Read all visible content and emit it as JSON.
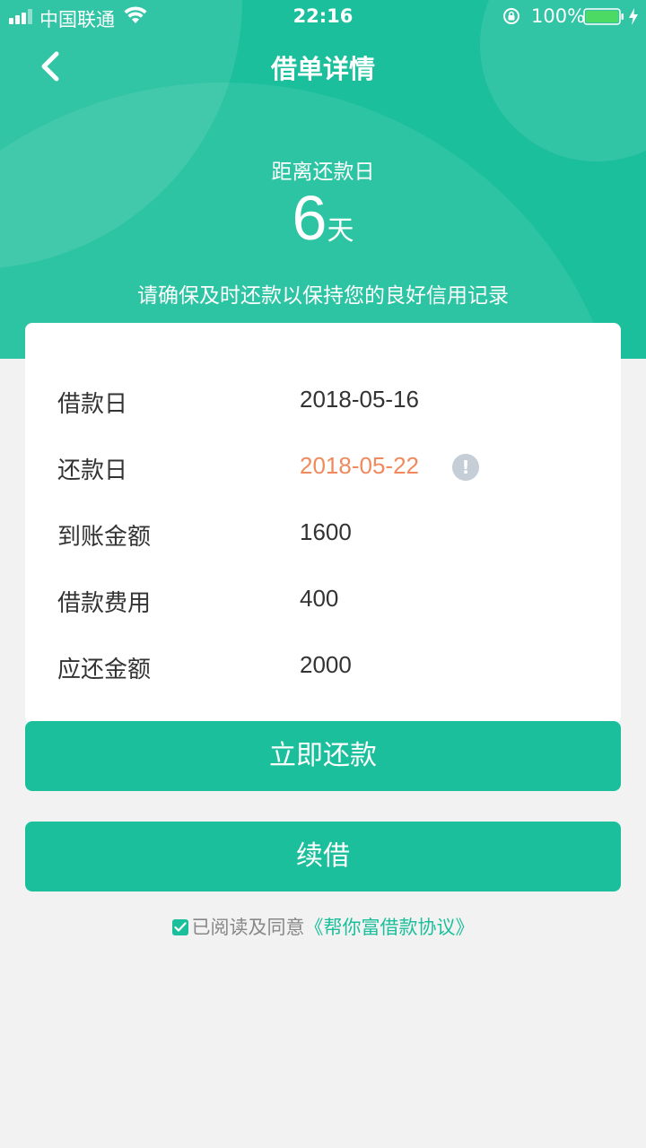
{
  "status_bar": {
    "carrier": "中国联通",
    "time": "22:16",
    "battery": "100%",
    "icons": [
      "signal-icon",
      "wifi-icon",
      "orientation-lock-icon",
      "battery-icon",
      "charging-icon"
    ]
  },
  "nav": {
    "title": "借单详情",
    "back_icon": "chevron-left-icon"
  },
  "countdown": {
    "label": "距离还款日",
    "days": "6",
    "unit": "天",
    "notice": "请确保及时还款以保持您的良好信用记录"
  },
  "details": [
    {
      "label": "借款日",
      "value": "2018-05-16"
    },
    {
      "label": "还款日",
      "value": "2018-05-22"
    },
    {
      "label": "到账金额",
      "value": "1600"
    },
    {
      "label": "借款费用",
      "value": "400"
    },
    {
      "label": "应还金额",
      "value": "2000"
    }
  ],
  "info_icon_glyph": "!",
  "buttons": {
    "repay": "立即还款",
    "renew": "续借"
  },
  "agreement": {
    "prefix": "已阅读及同意",
    "link": "《帮你富借款协议》",
    "checked": true
  },
  "colors": {
    "primary": "#1bbf9b",
    "highlight": "#f08a5d",
    "background": "#f2f2f2",
    "info_icon": "#c5cdd6"
  }
}
